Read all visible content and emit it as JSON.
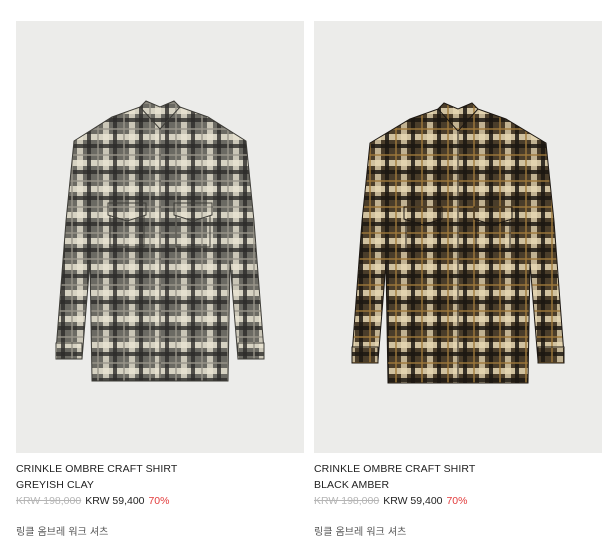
{
  "products": [
    {
      "name_line1": "CRINKLE OMBRE CRAFT SHIRT",
      "name_line2": "GREYISH CLAY",
      "original_price": "KRW 198,000",
      "sale_price": "KRW 59,400",
      "discount": "70%",
      "korean_name": "링클 옴브레 워크 셔츠",
      "shirt_colors": {
        "base": "#6b6a63",
        "light": "#e9e4d3",
        "dark": "#2d2c29"
      }
    },
    {
      "name_line1": "CRINKLE OMBRE CRAFT SHIRT",
      "name_line2": "BLACK AMBER",
      "original_price": "KRW 198,000",
      "sale_price": "KRW 59,400",
      "discount": "70%",
      "korean_name": "링클 옴브레 워크 셔츠",
      "shirt_colors": {
        "base": "#4a3d2a",
        "light": "#e8d9b4",
        "dark": "#1c1712"
      }
    }
  ],
  "colors": {
    "photo_bg": "#ececea",
    "discount": "#e23b3b",
    "strike": "#b5b5b5"
  }
}
